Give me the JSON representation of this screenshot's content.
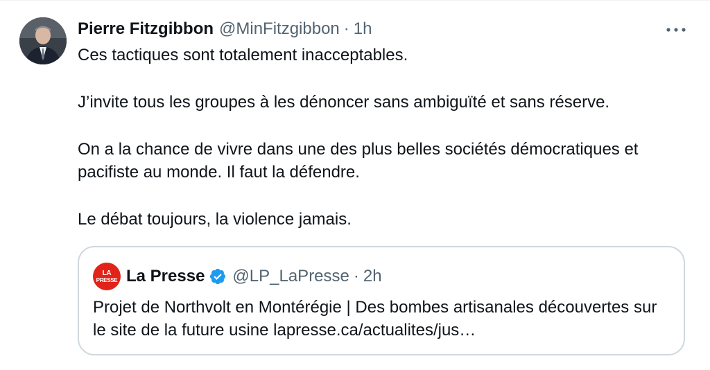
{
  "tweet": {
    "display_name": "Pierre Fitzgibbon",
    "handle": "@MinFitzgibbon",
    "separator": "·",
    "time": "1h",
    "more_icon": "more-horizontal-icon",
    "paragraphs": [
      "Ces tactiques sont totalement inacceptables.",
      "J’invite tous les groupes à les dénoncer sans ambiguïté et sans réserve.",
      "On a la chance de vivre dans une des plus belles sociétés démocratiques et pacifiste au monde. Il faut la défendre.",
      "Le débat toujours, la violence jamais."
    ]
  },
  "quote": {
    "logo_text_top": "LA",
    "logo_text_bottom": "PRESSE",
    "display_name": "La Presse",
    "verified_icon": "verified-badge-icon",
    "handle": "@LP_LaPresse",
    "separator": "·",
    "time": "2h",
    "text": "Projet de Northvolt en Montérégie | Des bombes artisanales découvertes sur le site de la future usine lapresse.ca/actualites/jus…"
  },
  "colors": {
    "text": "#0f1419",
    "secondary": "#536471",
    "border": "#cfd9de",
    "verified_blue": "#1d9bf0",
    "la_presse_red": "#e2231a"
  }
}
